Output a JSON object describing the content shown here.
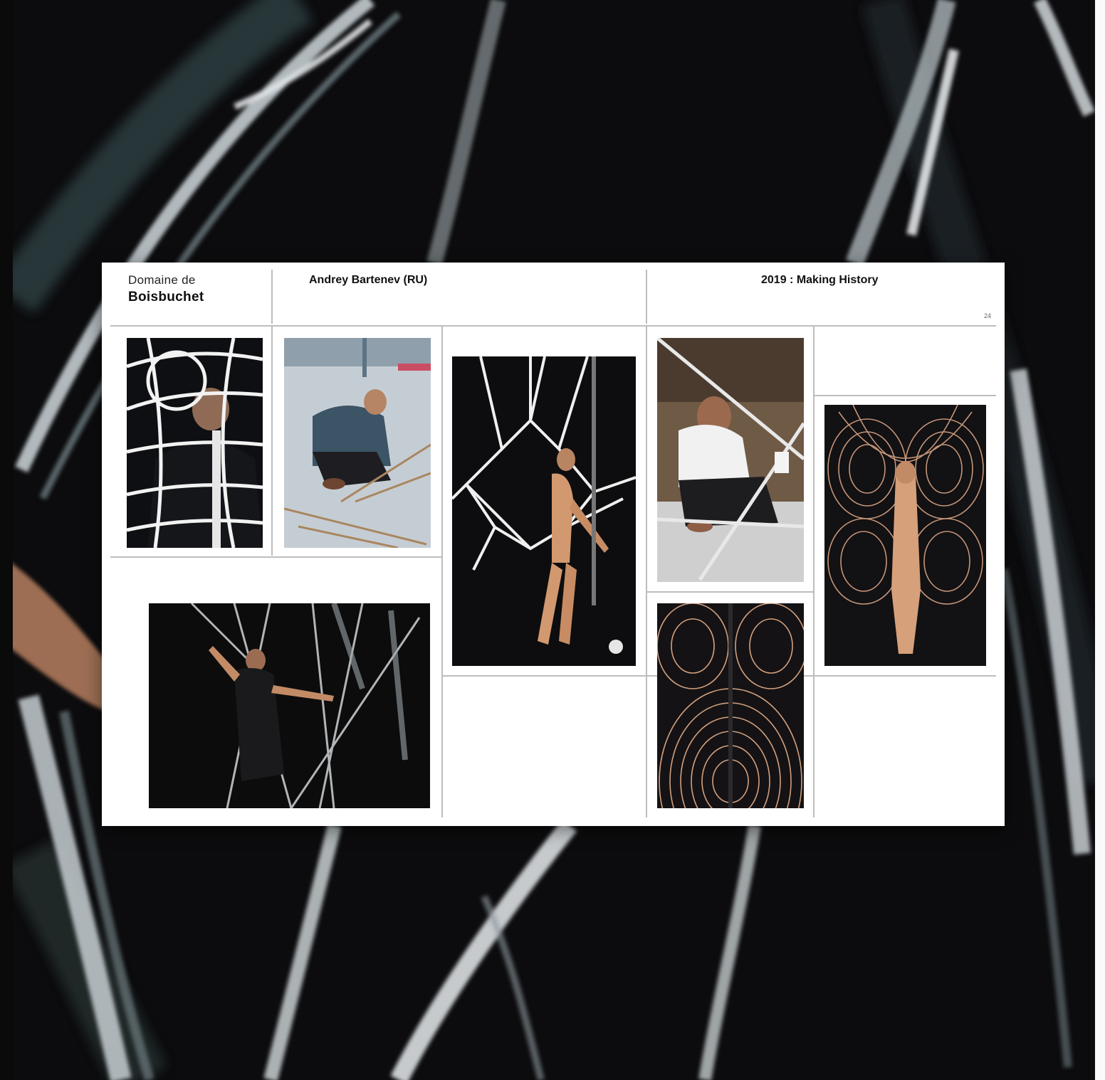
{
  "header": {
    "brand_line1": "Domaine de",
    "brand_line2": "Boisbuchet",
    "artist": "Andrey Bartenev (RU)",
    "edition": "2019 : Making History",
    "page_number": "24"
  },
  "colors": {
    "background": "#0c0c0e",
    "sheet": "#ffffff",
    "grid_lines": "#bdbdbd",
    "text": "#111111"
  }
}
